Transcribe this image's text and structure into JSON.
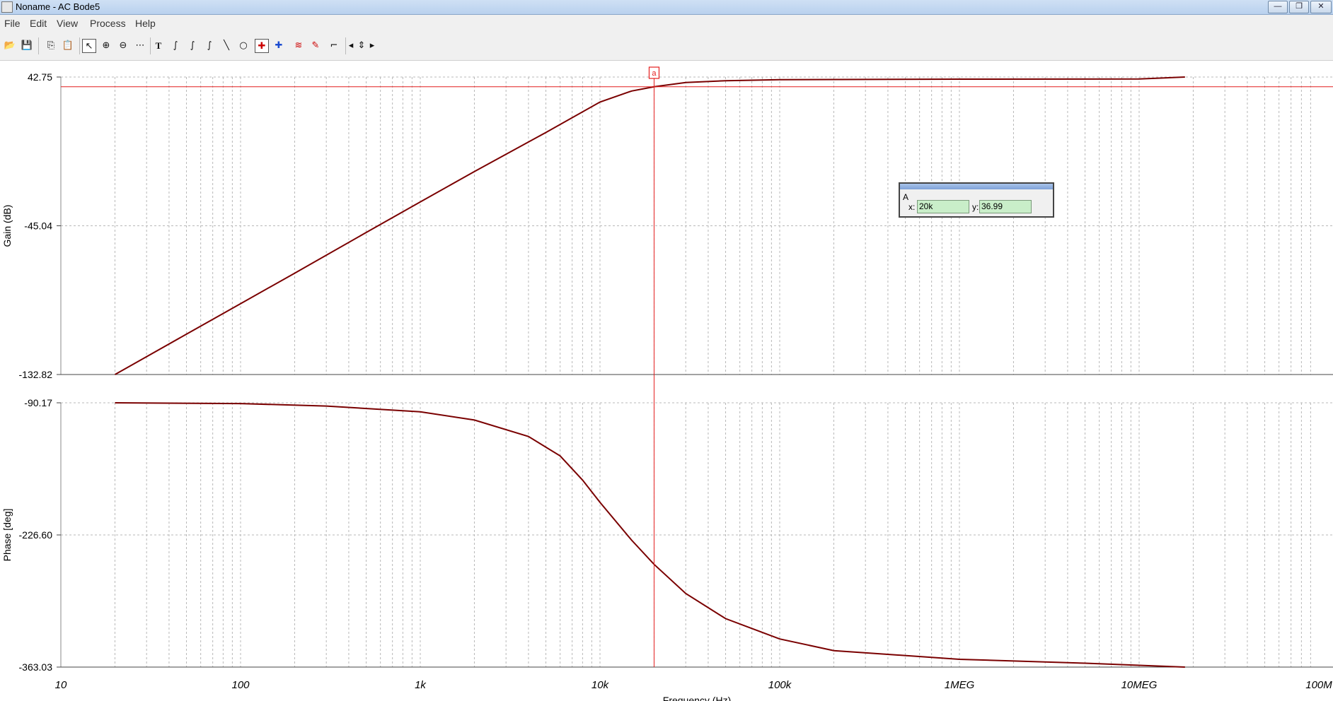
{
  "window": {
    "title": "Noname - AC Bode5",
    "controls": [
      "—",
      "❐",
      "✕"
    ]
  },
  "menu": [
    "File",
    "Edit",
    "View",
    "Process",
    "Help"
  ],
  "toolbar": [
    {
      "name": "open-icon",
      "glyph": "📂"
    },
    {
      "name": "save-icon",
      "glyph": "💾"
    },
    {
      "name": "copy-icon",
      "glyph": "⎘"
    },
    {
      "name": "paste-icon",
      "glyph": "📋"
    },
    {
      "name": "select-arrow-icon",
      "glyph": "↖"
    },
    {
      "name": "zoom-in-icon",
      "glyph": "⊕"
    },
    {
      "name": "zoom-out-icon",
      "glyph": "⊖"
    },
    {
      "name": "grid-icon",
      "glyph": "⋯"
    },
    {
      "name": "text-tool-icon",
      "glyph": "T"
    },
    {
      "name": "curve-tool-1-icon",
      "glyph": "∫"
    },
    {
      "name": "curve-tool-2-icon",
      "glyph": "∫"
    },
    {
      "name": "curve-tool-3-icon",
      "glyph": "∫"
    },
    {
      "name": "line-tool-icon",
      "glyph": "╲"
    },
    {
      "name": "circle-tool-icon",
      "glyph": "○"
    },
    {
      "name": "cursor-a-icon",
      "glyph": "✚"
    },
    {
      "name": "cursor-b-icon",
      "glyph": "✚"
    },
    {
      "name": "curve-select-icon",
      "glyph": "≋"
    },
    {
      "name": "probe-icon",
      "glyph": "✎"
    },
    {
      "name": "marker-icon",
      "glyph": "⌐"
    },
    {
      "name": "prev-icon",
      "glyph": "◂"
    },
    {
      "name": "updown-icon",
      "glyph": "⇕"
    },
    {
      "name": "next-icon",
      "glyph": "▸"
    }
  ],
  "cursor_readout": {
    "group": "A",
    "x_label": "x:",
    "x_value": "20k",
    "y_label": "y:",
    "y_value": "36.99"
  },
  "cursor_marker_label": "a",
  "colors": {
    "trace": "#7a0000",
    "cursor": "#e41f1f",
    "grid": "#b8b8b8",
    "window_bg": "#f0f0f0"
  },
  "chart_data": [
    {
      "type": "line",
      "panel": "gain",
      "ylabel": "Gain (dB)",
      "xscale": "log",
      "xlim": [
        10,
        100000000
      ],
      "ylim": [
        -132.82,
        42.75
      ],
      "yticks": [
        "42.75",
        "-45.04",
        "-132.82"
      ],
      "x": [
        20,
        50,
        100,
        200,
        500,
        1000,
        2000,
        5000,
        10000,
        15000,
        20000,
        30000,
        50000,
        100000,
        1000000,
        10000000,
        18000000
      ],
      "y": [
        -132.82,
        -109.0,
        -91.0,
        -73.0,
        -49.0,
        -31.0,
        -13.0,
        10.0,
        28.0,
        34.5,
        36.99,
        39.5,
        40.6,
        41.2,
        41.5,
        41.6,
        42.75
      ],
      "cursor": {
        "x": 20000,
        "y": 36.99
      }
    },
    {
      "type": "line",
      "panel": "phase",
      "ylabel": "Phase [deg]",
      "xlabel": "Frequency (Hz)",
      "xscale": "log",
      "xlim": [
        10,
        100000000
      ],
      "ylim": [
        -363.03,
        -90.17
      ],
      "yticks": [
        "-90.17",
        "-226.60",
        "-363.03"
      ],
      "xticks": [
        "10",
        "100",
        "1k",
        "10k",
        "100k",
        "1MEG",
        "10MEG",
        "100M"
      ],
      "x": [
        20,
        100,
        300,
        1000,
        2000,
        4000,
        6000,
        8000,
        10000,
        15000,
        20000,
        30000,
        50000,
        100000,
        200000,
        1000000,
        5000000,
        18000000
      ],
      "y": [
        -90.17,
        -91.0,
        -93.5,
        -99.5,
        -108.0,
        -125.0,
        -145.0,
        -170.0,
        -193.0,
        -232.0,
        -257.0,
        -287.0,
        -313.0,
        -334.0,
        -346.0,
        -355.0,
        -359.0,
        -363.03
      ]
    }
  ]
}
